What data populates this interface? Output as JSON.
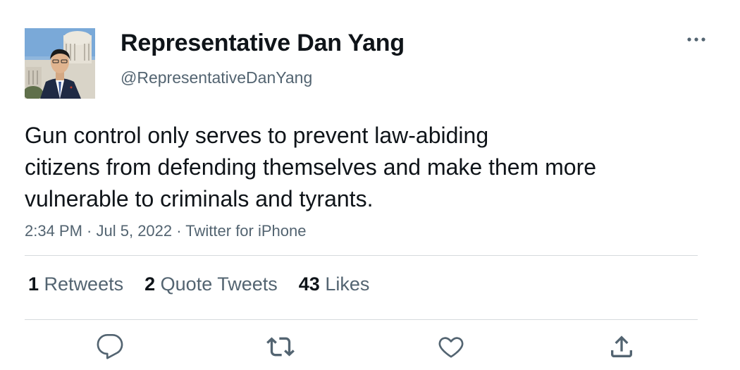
{
  "author": {
    "display_name": "Representative Dan Yang",
    "handle": "@RepresentativeDanYang"
  },
  "tweet": {
    "lines": [
      "Gun control only serves to prevent law-abiding",
      "citizens from defending themselves and make them more",
      "vulnerable to criminals and tyrants."
    ]
  },
  "meta": {
    "time": "2:34 PM",
    "sep1": " · ",
    "date": "Jul 5, 2022",
    "sep2": " · ",
    "source": "Twitter for iPhone"
  },
  "stats": {
    "retweets_count": "1",
    "retweets_label": "Retweets",
    "quotes_count": "2",
    "quotes_label": "Quote Tweets",
    "likes_count": "43",
    "likes_label": "Likes"
  },
  "icons": {
    "more": "more-icon",
    "reply": "reply-icon",
    "retweet": "retweet-icon",
    "like": "like-icon",
    "share": "share-icon"
  },
  "colors": {
    "text_primary": "#0f1419",
    "text_secondary": "#536471",
    "divider": "#d6dadd"
  }
}
